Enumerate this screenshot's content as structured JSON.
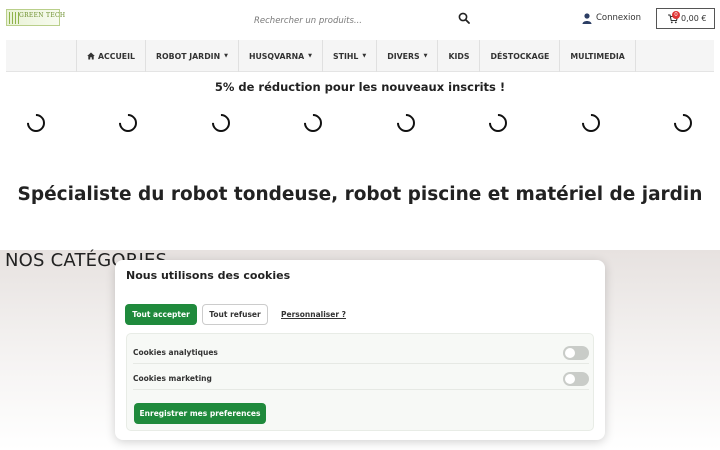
{
  "header": {
    "logo_text": "GREEN TECH",
    "search_placeholder": "Rechercher un produits...",
    "login_label": "Connexion",
    "cart_count": "0",
    "cart_amount": "0,00 €"
  },
  "nav": {
    "items": [
      {
        "label": "ACCUEIL"
      },
      {
        "label": "ROBOT JARDIN"
      },
      {
        "label": "HUSQVARNA"
      },
      {
        "label": "STIHL"
      },
      {
        "label": "DIVERS"
      },
      {
        "label": "KIDS"
      },
      {
        "label": "DÉSTOCKAGE"
      },
      {
        "label": "MULTIMEDIA"
      }
    ]
  },
  "promo": "5% de réduction pour les nouveaux inscrits !",
  "headline": "Spécialiste du robot tondeuse, robot piscine et matériel de jardin",
  "categories_title": "NOS CATÉGORIES",
  "cookie": {
    "title": "Nous utilisons des cookies",
    "accept_label": "Tout accepter",
    "refuse_label": "Tout refuser",
    "customize_label": "Personnaliser ?",
    "options": [
      {
        "label": "Cookies analytiques",
        "enabled": false
      },
      {
        "label": "Cookies marketing",
        "enabled": false
      }
    ],
    "save_label": "Enregistrer mes preferences"
  },
  "colors": {
    "accent_green": "#1f8a3c",
    "badge_red": "#e03535"
  }
}
